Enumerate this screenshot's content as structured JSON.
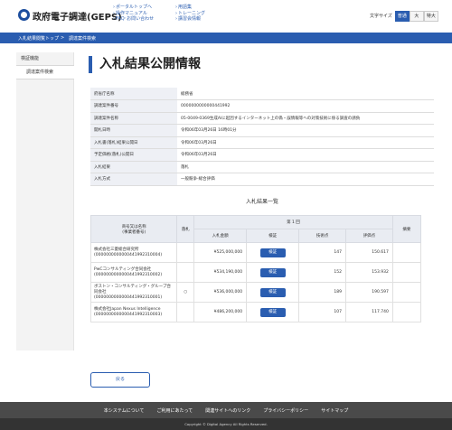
{
  "header": {
    "site_title": "政府電子調達(GEPS)",
    "nav_col1": [
      "ポータルトップへ",
      "操作マニュアル",
      "FAQ･お問い合わせ"
    ],
    "nav_col2": [
      "用語集",
      "トレーニング",
      "講習会情報"
    ],
    "font_size_label": "文字サイズ",
    "font_sizes": [
      "普通",
      "大",
      "特大"
    ],
    "accent": "#2a5db0"
  },
  "breadcrumb": [
    "入札結果閲覧トップ",
    "調達案件検索"
  ],
  "sidebar": {
    "items": [
      "検証機能",
      "調達案件検索"
    ]
  },
  "main": {
    "page_title": "入札結果公開情報",
    "info": [
      {
        "label": "府省庁名称",
        "value": "総務省"
      },
      {
        "label": "調達案件番号",
        "value": "0000000000000441992"
      },
      {
        "label": "調達案件名称",
        "value": "05-0049-0369生成AIに起因するインターネット上の偽・誤情報等への対策技術に係る調査の請負"
      },
      {
        "label": "開札日時",
        "value": "令和06年03月26日 16時01分"
      },
      {
        "label": "入札書(落札)結果公開日",
        "value": "令和06年03月26日"
      },
      {
        "label": "予定価格(落札)公開日",
        "value": "令和06年03月26日"
      },
      {
        "label": "入札結果",
        "value": "落札"
      },
      {
        "label": "入札方式",
        "value": "一般競争-総合評価"
      }
    ],
    "results_title": "入札結果一覧",
    "results_headers": {
      "company": "商号又は名称\n(事業者番号)",
      "winner": "落札",
      "round": "第 1 回",
      "amount": "入札金額",
      "detail": "検証",
      "tech": "技術点",
      "eval": "評価点",
      "remarks": "摘要"
    },
    "results": [
      {
        "name": "株式会社三菱総合研究所",
        "id": "(0000000000000441992310004)",
        "winner": "",
        "amount": "¥525,000,000",
        "detail": "検証",
        "tech": "147",
        "eval": "150.617",
        "remarks": ""
      },
      {
        "name": "PwCコンサルティング合同会社",
        "id": "(0000000000000441992310002)",
        "winner": "",
        "amount": "¥534,190,000",
        "detail": "検証",
        "tech": "152",
        "eval": "153.932",
        "remarks": ""
      },
      {
        "name": "ボストン・コンサルティング・グループ合同会社",
        "id": "(0000000000000441992310001)",
        "winner": "○",
        "amount": "¥536,000,000",
        "detail": "検証",
        "tech": "189",
        "eval": "190.597",
        "remarks": ""
      },
      {
        "name": "株式会社Japan Nexus Intelligence",
        "id": "(0000000000000441992310003)",
        "winner": "",
        "amount": "¥486,200,000",
        "detail": "検証",
        "tech": "107",
        "eval": "117.740",
        "remarks": ""
      }
    ],
    "back_label": "戻る"
  },
  "footer": {
    "links": [
      "本システムについて",
      "ご利用にあたって",
      "関連サイトへのリンク",
      "プライバシーポリシー",
      "サイトマップ"
    ],
    "copyright": "Copyright © Digital Agency All Rights Reserved."
  }
}
